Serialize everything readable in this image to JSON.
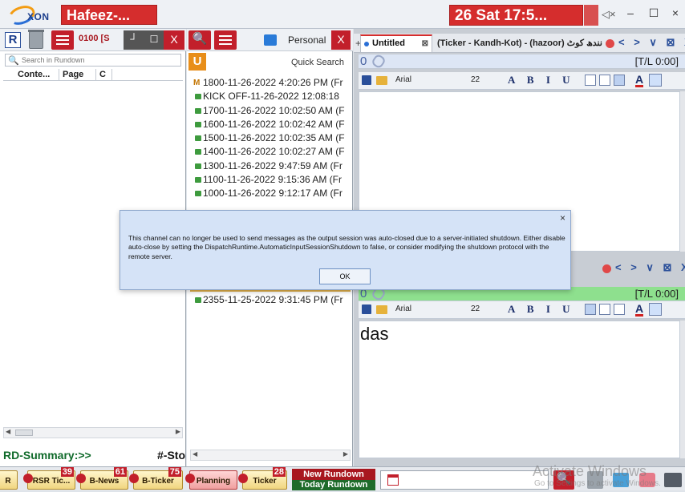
{
  "titlebar": {
    "logo_text": "XON",
    "user_title": "Hafeez-...",
    "date_time": "26 Sat 17:5...",
    "mute_icon": "speaker-mute-icon",
    "min_icon": "–",
    "max_icon": "☐",
    "close_icon": "×"
  },
  "left_panel": {
    "r_label": "R",
    "code_label": "0100 [S",
    "close_label": "X",
    "search_placeholder": "Search in Rundown",
    "columns": [
      "Conte...",
      "Page",
      "C"
    ],
    "rd_summary": "RD-Summary:>>",
    "sto_label": "#-Sto"
  },
  "mid_panel": {
    "close_label": "X",
    "tab_label": "Personal",
    "u_label": "U",
    "quick_search": "Quick Search",
    "items": [
      {
        "icon": "M",
        "text": "1800-11-26-2022 4:20:26 PM (Fr"
      },
      {
        "icon": "green",
        "text": "KICK OFF-11-26-2022 12:08:18"
      },
      {
        "icon": "green",
        "text": "1700-11-26-2022 10:02:50 AM (F"
      },
      {
        "icon": "green",
        "text": "1600-11-26-2022 10:02:42 AM (F"
      },
      {
        "icon": "green",
        "text": "1500-11-26-2022 10:02:35 AM (F"
      },
      {
        "icon": "green",
        "text": "1400-11-26-2022 10:02:27 AM (F"
      },
      {
        "icon": "green",
        "text": "1300-11-26-2022 9:47:59 AM (Fr"
      },
      {
        "icon": "green",
        "text": "1100-11-26-2022 9:15:36 AM (Fr"
      },
      {
        "icon": "green",
        "text": "1000-11-26-2022 9:12:17 AM (Fr"
      }
    ],
    "last_item": "2355-11-25-2022 9:31:45 PM (Fr"
  },
  "editor": {
    "tab_untitled": "Untitled",
    "tab_untitled_close": "⊠",
    "tab_ticker": "(Ticker - Kandh-Kot) - (hazoor) نندھ کوٹ",
    "nav_arrows": "< > ∨ ⊠ X",
    "status_zero": "0",
    "tl_label": "[T/L 0:00]",
    "font_name": "Arial",
    "font_size": "22",
    "format_buttons": "A B I U",
    "editor2_text": "das"
  },
  "dialog": {
    "message": "This channel can no longer be used to send messages as the output session was auto-closed due to a server-initiated shutdown. Either disable auto-close by setting the DispatchRuntime.AutomaticInputSessionShutdown to false, or consider modifying the shutdown protocol with the remote server.",
    "close_label": "×",
    "ok_label": "OK"
  },
  "taskbar": {
    "buttons": [
      {
        "label": "R",
        "count": ""
      },
      {
        "label": "RSR Tic...",
        "count": "39"
      },
      {
        "label": "B-News",
        "count": "61"
      },
      {
        "label": "B-Ticker",
        "count": "75"
      },
      {
        "label": "Planning",
        "count": ""
      },
      {
        "label": "Ticker",
        "count": "28"
      }
    ],
    "new_rundown": "New Rundown",
    "today_rundown": "Today Rundown",
    "watermark": "Activate Windows",
    "watermark_sub": "Go to Settings to activate Windows."
  }
}
